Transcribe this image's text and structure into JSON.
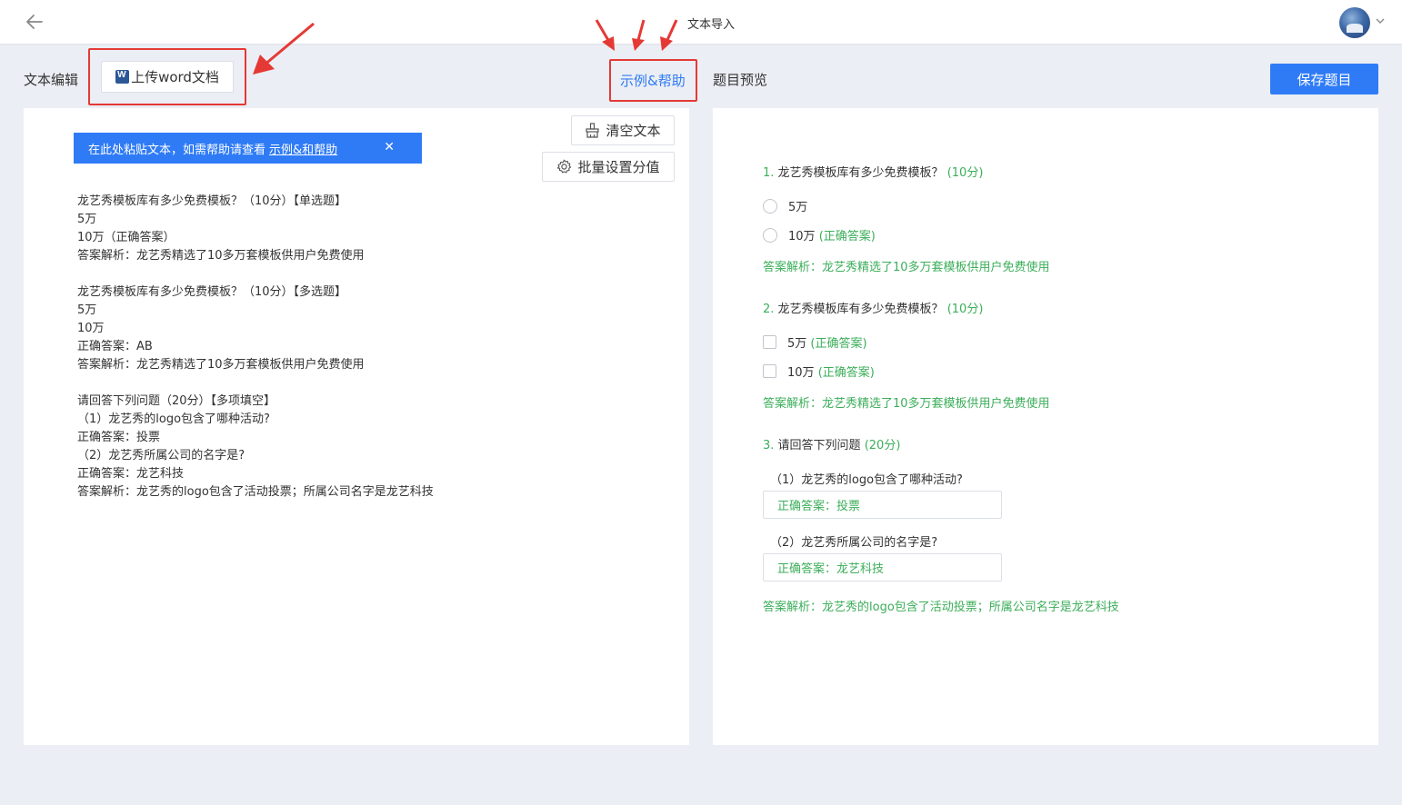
{
  "header": {
    "title": "文本导入"
  },
  "toolbar": {
    "left_label": "文本编辑",
    "upload_label": "上传word文档",
    "help_label": "示例&帮助",
    "preview_label": "题目预览",
    "save_label": "保存题目"
  },
  "editor": {
    "tip_text": "在此处粘贴文本，如需帮助请查看",
    "tip_link": "示例&和帮助",
    "tip_close": "✕",
    "clear_label": "清空文本",
    "batch_label": "批量设置分值",
    "lines": [
      "龙艺秀模板库有多少免费模板？（10分）【单选题】",
      "5万",
      "10万（正确答案）",
      "答案解析：龙艺秀精选了10多万套模板供用户免费使用",
      "",
      "龙艺秀模板库有多少免费模板？（10分）【多选题】",
      "5万",
      "10万",
      "正确答案：AB",
      "答案解析：龙艺秀精选了10多万套模板供用户免费使用",
      "",
      "请回答下列问题（20分）【多项填空】",
      "（1）龙艺秀的logo包含了哪种活动?",
      "正确答案：投票",
      "（2）龙艺秀所属公司的名字是?",
      "正确答案：龙艺科技",
      "答案解析：龙艺秀的logo包含了活动投票；所属公司名字是龙艺科技"
    ]
  },
  "preview": {
    "q1": {
      "num": "1.",
      "text": "龙艺秀模板库有多少免费模板？",
      "score": "(10分)",
      "options": [
        {
          "label": "5万",
          "tag": ""
        },
        {
          "label": "10万",
          "tag": "(正确答案)"
        }
      ],
      "analysis": "答案解析：龙艺秀精选了10多万套模板供用户免费使用"
    },
    "q2": {
      "num": "2.",
      "text": "龙艺秀模板库有多少免费模板？",
      "score": "(10分)",
      "options": [
        {
          "label": "5万",
          "tag": "(正确答案)"
        },
        {
          "label": "10万",
          "tag": "(正确答案)"
        }
      ],
      "analysis": "答案解析：龙艺秀精选了10多万套模板供用户免费使用"
    },
    "q3": {
      "num": "3.",
      "text": "请回答下列问题",
      "score": "(20分)",
      "subs": [
        {
          "question": "（1）龙艺秀的logo包含了哪种活动?",
          "answer": "正确答案：投票"
        },
        {
          "question": "（2）龙艺秀所属公司的名字是?",
          "answer": "正确答案：龙艺科技"
        }
      ],
      "analysis": "答案解析：龙艺秀的logo包含了活动投票；所属公司名字是龙艺科技"
    }
  },
  "colors": {
    "primary": "#2f7bf6",
    "correct": "#3cae5a",
    "annotation": "#e53935"
  },
  "icons": {
    "back": "arrow-left-icon",
    "upload": "word-doc-icon",
    "clear": "broom-icon",
    "batch": "gear-icon",
    "close": "close-icon",
    "avatar_caret": "chevron-down-icon"
  }
}
